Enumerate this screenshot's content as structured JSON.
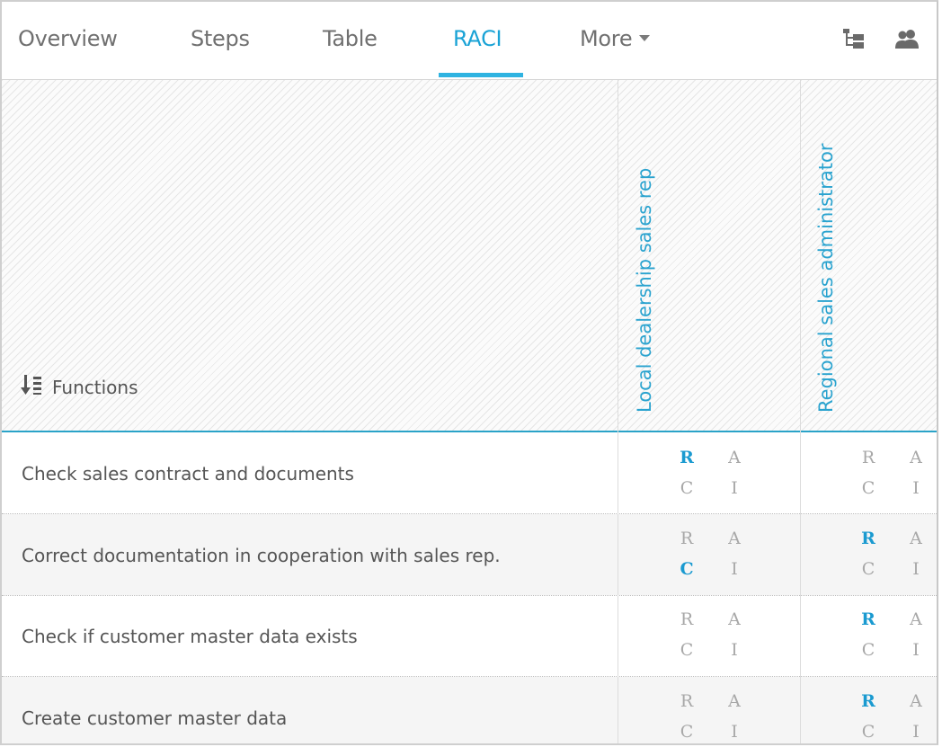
{
  "tabs": [
    {
      "label": "Overview",
      "active": false
    },
    {
      "label": "Steps",
      "active": false
    },
    {
      "label": "Table",
      "active": false
    },
    {
      "label": "RACI",
      "active": true
    },
    {
      "label": "More",
      "active": false
    }
  ],
  "toolbar": {
    "icons": [
      "hierarchy-icon",
      "users-icon"
    ]
  },
  "matrix": {
    "functions_header": "Functions",
    "roles": [
      "Local dealership sales rep",
      "Regional sales administrator"
    ],
    "raci_letters": [
      "R",
      "A",
      "C",
      "I"
    ],
    "rows": [
      {
        "label": "Check sales contract and documents",
        "assignments": [
          [
            "R"
          ],
          []
        ]
      },
      {
        "label": "Correct documentation in cooperation with sales rep.",
        "assignments": [
          [
            "C"
          ],
          [
            "R"
          ]
        ]
      },
      {
        "label": "Check if customer master data exists",
        "assignments": [
          [],
          [
            "R"
          ]
        ]
      },
      {
        "label": "Create customer master data",
        "assignments": [
          [],
          [
            "R"
          ]
        ]
      }
    ]
  },
  "colors": {
    "accent": "#1aa3d6",
    "inactive_letter": "#a8a8a8",
    "header_rule": "#2aa3c8"
  }
}
